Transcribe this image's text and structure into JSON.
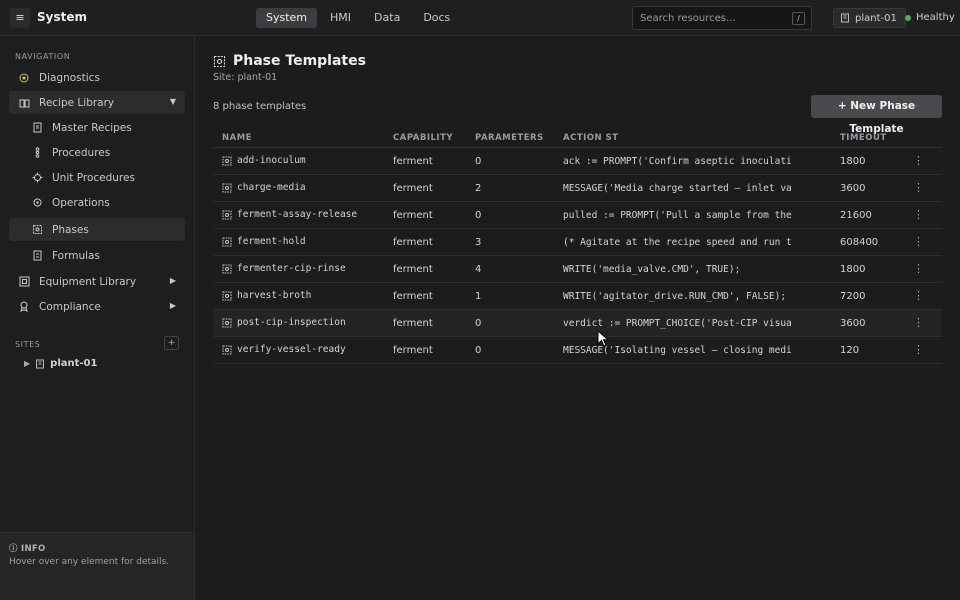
{
  "header": {
    "menu_icon": "hamburger-icon",
    "title": "System",
    "tabs": [
      {
        "label": "System",
        "active": true
      },
      {
        "label": "HMI",
        "active": false
      },
      {
        "label": "Data",
        "active": false
      },
      {
        "label": "Docs",
        "active": false
      }
    ],
    "search_placeholder": "Search resources...",
    "search_shortcut": "/",
    "site_chip": "plant-01",
    "health_label": "Healthy",
    "health_color": "#3fb950"
  },
  "sidebar": {
    "nav_heading": "NAVIGATION",
    "items": [
      {
        "label": "Diagnostics",
        "icon": "target-icon"
      },
      {
        "label": "Recipe Library",
        "icon": "book-icon",
        "arrow": "▼"
      },
      {
        "label": "Master Recipes",
        "icon": "document-icon"
      },
      {
        "label": "Procedures",
        "icon": "procedure-icon"
      },
      {
        "label": "Unit Procedures",
        "icon": "unit-procedure-icon"
      },
      {
        "label": "Operations",
        "icon": "operations-icon"
      },
      {
        "label": "Phases",
        "icon": "phase-gear-icon"
      },
      {
        "label": "Formulas",
        "icon": "formula-icon"
      },
      {
        "label": "Equipment Library",
        "icon": "equipment-icon",
        "arrow": "▶"
      },
      {
        "label": "Compliance",
        "icon": "compliance-icon",
        "arrow": "▶"
      }
    ],
    "sites_heading": "SITES",
    "add_label": "+",
    "site_node": "plant-01",
    "site_arrow": "▶",
    "info_title": "ⓘ INFO",
    "info_text": "Hover over any element for details."
  },
  "main": {
    "title": "Phase Templates",
    "site_label": "Site: plant-01",
    "count_label": "8 phase templates",
    "new_button": "+ New Phase Template",
    "columns": [
      "NAME",
      "CAPABILITY",
      "PARAMETERS",
      "ACTION ST",
      "TIMEOUT"
    ],
    "rows": [
      {
        "name": "add-inoculum",
        "capability": "ferment",
        "parameters": "0",
        "action": "ack := PROMPT('Confirm aseptic inoculati",
        "timeout": "1800"
      },
      {
        "name": "charge-media",
        "capability": "ferment",
        "parameters": "2",
        "action": "MESSAGE('Media charge started — inlet va",
        "timeout": "3600"
      },
      {
        "name": "ferment-assay-release",
        "capability": "ferment",
        "parameters": "0",
        "action": "pulled := PROMPT('Pull a sample from the",
        "timeout": "21600"
      },
      {
        "name": "ferment-hold",
        "capability": "ferment",
        "parameters": "3",
        "action": "(* Agitate at the recipe speed and run t",
        "timeout": "608400"
      },
      {
        "name": "fermenter-cip-rinse",
        "capability": "ferment",
        "parameters": "4",
        "action": "WRITE('media_valve.CMD', TRUE);",
        "timeout": "1800"
      },
      {
        "name": "harvest-broth",
        "capability": "ferment",
        "parameters": "1",
        "action": "WRITE('agitator_drive.RUN_CMD', FALSE);",
        "timeout": "7200"
      },
      {
        "name": "post-cip-inspection",
        "capability": "ferment",
        "parameters": "0",
        "action": "verdict := PROMPT_CHOICE('Post-CIP visua",
        "timeout": "3600"
      },
      {
        "name": "verify-vessel-ready",
        "capability": "ferment",
        "parameters": "0",
        "action": "MESSAGE('Isolating vessel — closing medi",
        "timeout": "120"
      }
    ],
    "row_menu_glyph": "⋮"
  }
}
